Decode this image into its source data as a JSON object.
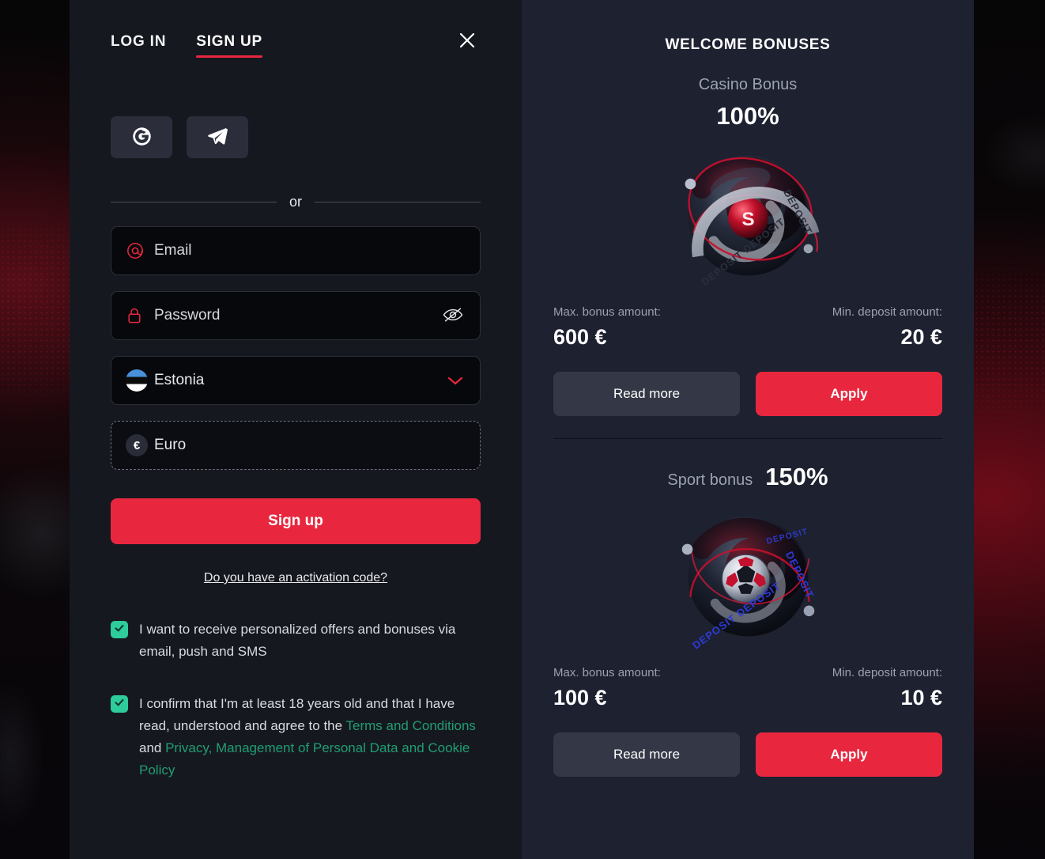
{
  "auth": {
    "tabs": [
      {
        "label": "LOG IN",
        "active": false
      },
      {
        "label": "SIGN UP",
        "active": true
      }
    ],
    "close_icon": "close-icon",
    "social": [
      {
        "name": "google-login-button",
        "icon": "google-icon"
      },
      {
        "name": "telegram-login-button",
        "icon": "telegram-icon"
      }
    ],
    "divider_text": "or",
    "email": {
      "icon": "at-icon",
      "placeholder": "Email",
      "value": ""
    },
    "password": {
      "icon": "lock-icon",
      "placeholder": "Password",
      "value": "",
      "toggle_icon": "eye-off-icon"
    },
    "country": {
      "icon": "flag-estonia-icon",
      "value": "Estonia",
      "chevron_icon": "chevron-down-icon"
    },
    "currency": {
      "icon": "euro-icon",
      "symbol": "€",
      "value": "Euro"
    },
    "submit_label": "Sign up",
    "activation_link": "Do you have an activation code?",
    "consents": [
      {
        "checked": true,
        "text": "I want to receive personalized offers and bonuses via email, push and SMS"
      },
      {
        "checked": true,
        "prefix": "I confirm that I'm at least 18 years old and that I have read, understood and agree to the ",
        "link1": "Terms and Conditions",
        "middle": " and ",
        "link2": "Privacy, Management of Personal Data and Cookie Policy"
      }
    ]
  },
  "bonuses": {
    "title": "WELCOME BONUSES",
    "items": [
      {
        "name": "Casino Bonus",
        "percent": "100%",
        "layout": "stacked",
        "graphic": "casino-deposit-orb-icon",
        "max_label": "Max. bonus amount:",
        "max_value": "600 €",
        "min_label": "Min. deposit amount:",
        "min_value": "20 €",
        "read_more_label": "Read more",
        "apply_label": "Apply"
      },
      {
        "name": "Sport bonus",
        "percent": "150%",
        "layout": "inline",
        "graphic": "sport-deposit-orb-icon",
        "max_label": "Max. bonus amount:",
        "max_value": "100 €",
        "min_label": "Min. deposit amount:",
        "min_value": "10 €",
        "read_more_label": "Read more",
        "apply_label": "Apply"
      }
    ]
  },
  "colors": {
    "accent_red": "#e8273f",
    "check_green": "#2ecc9b",
    "link_green": "#1f9e72",
    "left_panel_bg": "#16181f",
    "right_panel_bg": "#1d2130"
  }
}
